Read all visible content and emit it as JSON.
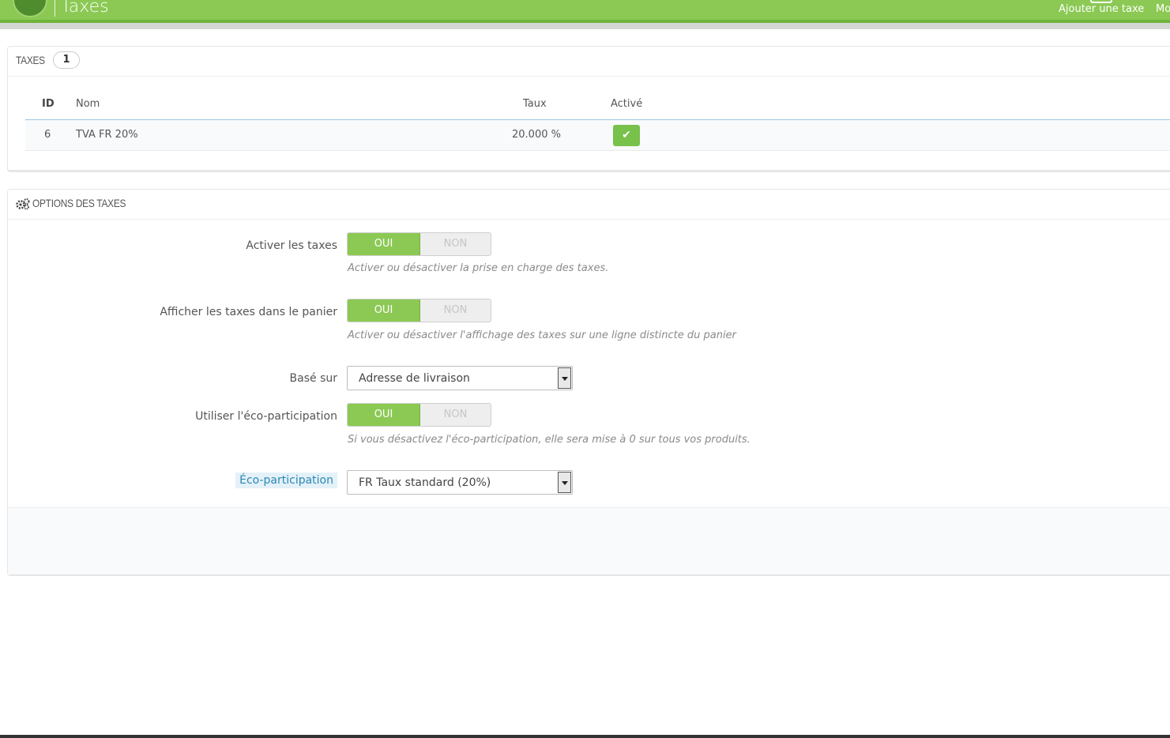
{
  "header": {
    "title": "Taxes",
    "toolbar": {
      "add_tax": "Ajouter une taxe",
      "more_truncated": "Mo"
    },
    "colors": {
      "brand_green": "#8bc954"
    }
  },
  "taxes_panel": {
    "heading": "TAXES",
    "count": "1",
    "columns": {
      "id": "ID",
      "name": "Nom",
      "rate": "Taux",
      "active": "Activé"
    },
    "rows": [
      {
        "id": "6",
        "name": "TVA FR 20%",
        "rate": "20.000 %",
        "active": true,
        "active_icon": "check-icon"
      }
    ]
  },
  "options_panel": {
    "heading": "OPTIONS DES TAXES",
    "heading_icon": "cogs-icon",
    "fields": [
      {
        "label": "Activer les taxes",
        "type": "switch",
        "on_label": "OUI",
        "off_label": "NON",
        "value": "OUI",
        "help": "Activer ou désactiver la prise en charge des taxes."
      },
      {
        "label": "Afficher les taxes dans le panier",
        "type": "switch",
        "on_label": "OUI",
        "off_label": "NON",
        "value": "OUI",
        "help": "Activer ou désactiver l'affichage des taxes sur une ligne distincte du panier"
      },
      {
        "label": "Basé sur",
        "type": "select",
        "value": "Adresse de livraison"
      },
      {
        "label": "Utiliser l'éco-participation",
        "type": "switch",
        "on_label": "OUI",
        "off_label": "NON",
        "value": "OUI",
        "help": "Si vous désactivez l'éco-participation, elle sera mise à 0 sur tous vos produits."
      },
      {
        "label": "Éco-participation",
        "type": "select",
        "value": "FR Taux standard (20%)"
      }
    ]
  }
}
